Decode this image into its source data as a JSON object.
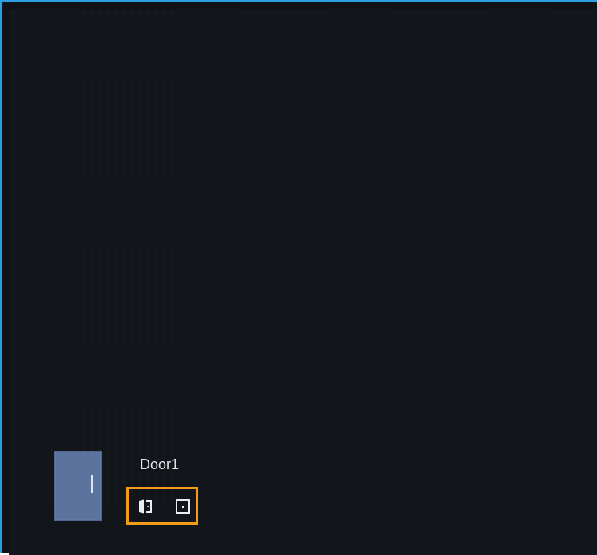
{
  "door": {
    "name": "Door1",
    "icon": "door-icon"
  },
  "controls": {
    "open_door_icon": "door-open-icon",
    "close_door_icon": "door-close-icon",
    "highlight_color": "#f39c1a"
  },
  "colors": {
    "frame_border": "#2b9fe0",
    "background": "#121519",
    "door_tile": "#5b739d"
  }
}
